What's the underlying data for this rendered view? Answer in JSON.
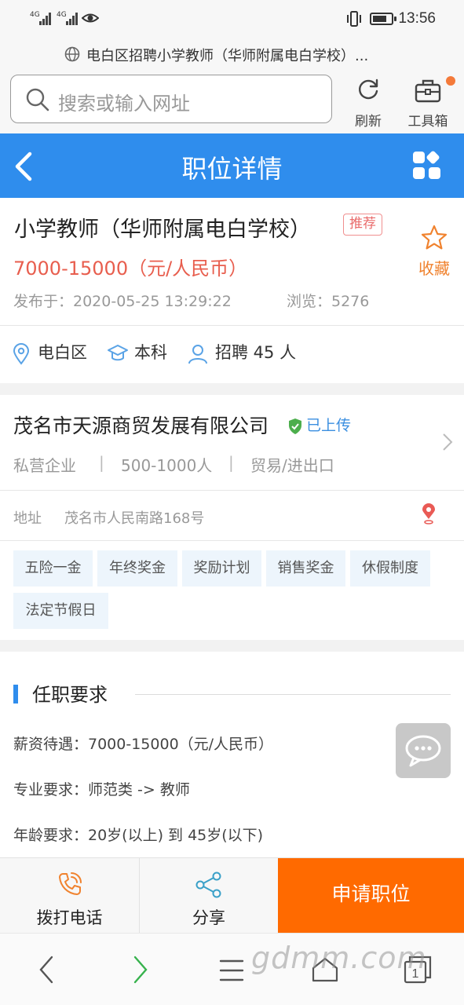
{
  "status_bar": {
    "signal_1": "4G",
    "signal_2": "4G",
    "time": "13:56",
    "battery_level": 0.75
  },
  "browser": {
    "page_title": "电白区招聘小学教师（华师附属电白学校）...",
    "search_placeholder": "搜索或输入网址",
    "refresh_label": "刷新",
    "toolbox_label": "工具箱"
  },
  "header": {
    "title": "职位详情"
  },
  "job": {
    "title": "小学教师（华师附属电白学校）",
    "badge": "推荐",
    "favorite_label": "收藏",
    "salary": "7000-15000（元/人民币）",
    "published": "发布于：2020-05-25 13:29:22",
    "views": "浏览：5276",
    "location": "电白区",
    "education": "本科",
    "headcount": "招聘 45 人"
  },
  "company": {
    "name": "茂名市天源商贸发展有限公司",
    "verified": "已上传",
    "type": "私营企业",
    "size": "500-1000人",
    "industry": "贸易/进出口",
    "address_label": "地址",
    "address": "茂名市人民南路168号",
    "perks": [
      "五险一金",
      "年终奖金",
      "奖励计划",
      "销售奖金",
      "休假制度",
      "法定节假日"
    ]
  },
  "requirements": {
    "title": "任职要求",
    "rows": [
      "薪资待遇：7000-15000（元/人民币）",
      "专业要求：师范类 -> 教师",
      "年龄要求：20岁(以上) 到 45岁(以下)"
    ]
  },
  "actions": {
    "call_label": "拨打电话",
    "share_label": "分享",
    "apply_label": "申请职位"
  },
  "watermark": "gdmm.com",
  "tabs_count": "1"
}
